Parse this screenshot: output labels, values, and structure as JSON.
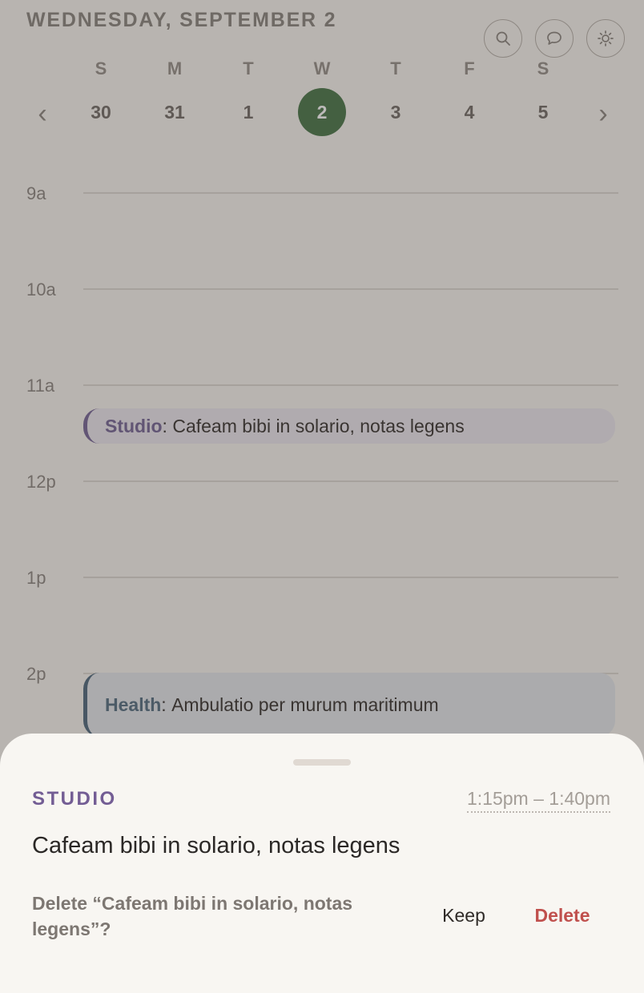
{
  "header": {
    "date_title": "WEDNESDAY, SEPTEMBER 2",
    "icons": [
      "search-icon",
      "chat-bubble-icon",
      "sun-icon"
    ]
  },
  "week": {
    "prev_arrow": "‹",
    "next_arrow": "›",
    "days": [
      {
        "dow": "S",
        "date": "30"
      },
      {
        "dow": "M",
        "date": "31"
      },
      {
        "dow": "T",
        "date": "1"
      },
      {
        "dow": "W",
        "date": "2",
        "selected": true
      },
      {
        "dow": "T",
        "date": "3"
      },
      {
        "dow": "F",
        "date": "4"
      },
      {
        "dow": "S",
        "date": "5"
      }
    ]
  },
  "timeline": {
    "hours": [
      "9a",
      "10a",
      "11a",
      "12p",
      "1p",
      "2p"
    ],
    "events": [
      {
        "category": "Studio",
        "separator": ": ",
        "title": "Cafeam bibi in solario, notas legens",
        "color": "#7a6a9a"
      },
      {
        "category": "Health",
        "separator": ": ",
        "title": "Ambulatio per murum maritimum",
        "color": "#5a7387"
      }
    ]
  },
  "sheet": {
    "category": "STUDIO",
    "time_range": "1:15pm – 1:40pm",
    "title": "Cafeam bibi in solario, notas legens",
    "confirm_message": "Delete “Cafeam bibi in solario, notas legens”?",
    "keep_label": "Keep",
    "delete_label": "Delete",
    "accent": "#735d94",
    "danger": "#c0504d"
  },
  "colors": {
    "selected_day": "#4e7b4f",
    "background": "#faf7f2"
  }
}
